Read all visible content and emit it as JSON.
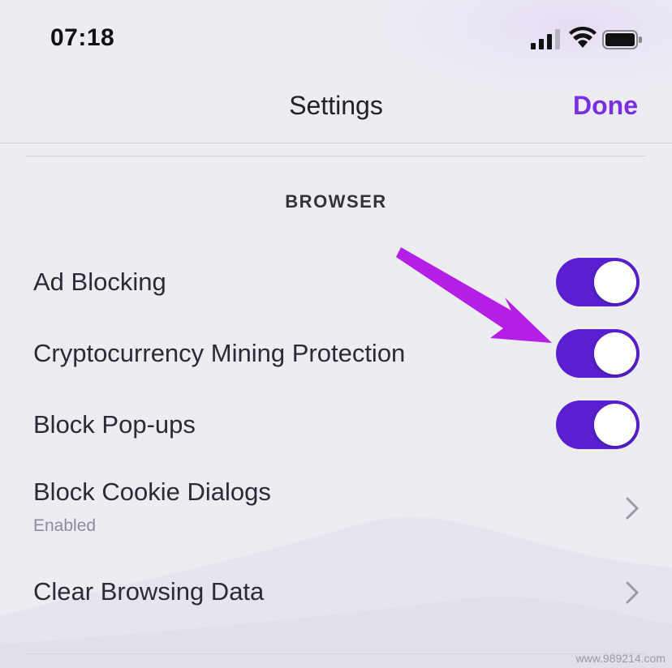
{
  "status_bar": {
    "time": "07:18"
  },
  "nav": {
    "title": "Settings",
    "done_label": "Done"
  },
  "section": {
    "header": "BROWSER"
  },
  "rows": [
    {
      "label": "Ad Blocking",
      "control": "toggle",
      "value": true
    },
    {
      "label": "Cryptocurrency Mining Protection",
      "control": "toggle",
      "value": true
    },
    {
      "label": "Block Pop-ups",
      "control": "toggle",
      "value": true
    },
    {
      "label": "Block Cookie Dialogs",
      "subtitle": "Enabled",
      "control": "chevron"
    },
    {
      "label": "Clear Browsing Data",
      "control": "chevron"
    }
  ],
  "watermark": "www.989214.com",
  "colors": {
    "accent": "#7b2ee0",
    "toggle_on": "#5a1fd0",
    "arrow": "#b51ee6"
  }
}
